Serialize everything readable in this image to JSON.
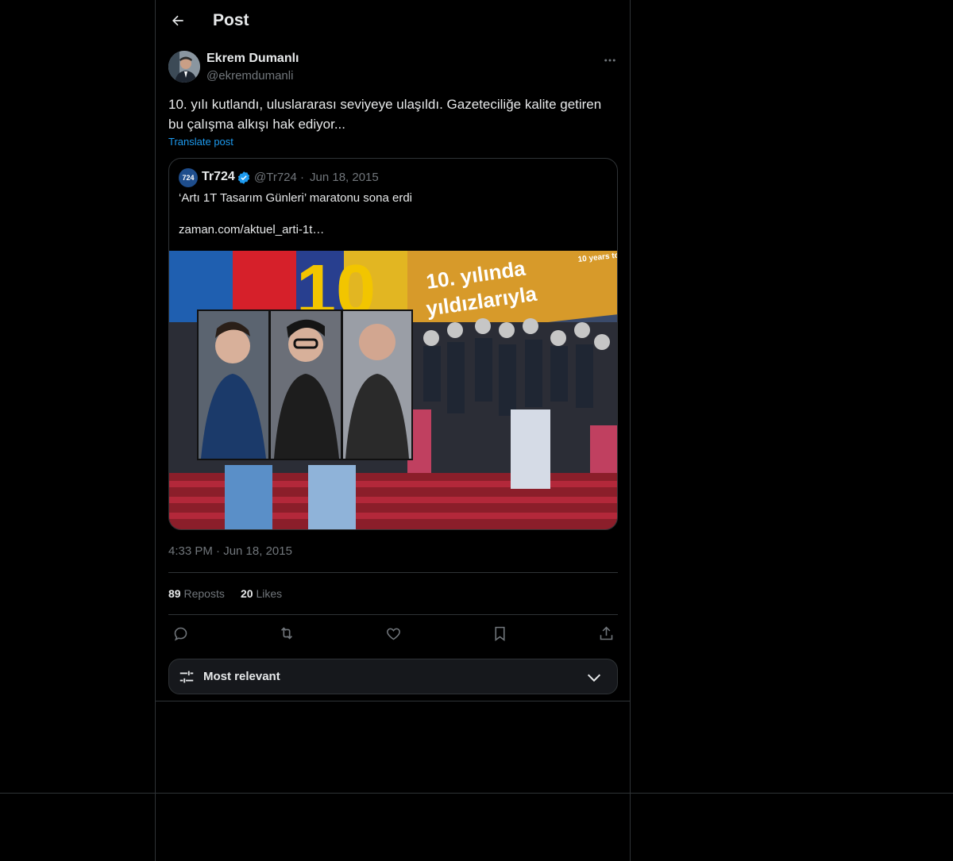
{
  "header": {
    "title": "Post"
  },
  "author": {
    "name": "Ekrem Dumanlı",
    "handle": "@ekremdumanli"
  },
  "post": {
    "text": "10. yılı kutlandı, uluslararası seviyeye ulaşıldı. Gazeteciliğe kalite getiren bu çalışma alkışı hak ediyor...",
    "translate_label": "Translate post",
    "timestamp": "4:33 PM · Jun 18, 2015"
  },
  "quote": {
    "logo_text": "724",
    "name": "Tr724",
    "verified": true,
    "handle": "@Tr724",
    "separator": "·",
    "date": "Jun 18, 2015",
    "text": "‘Artı 1T Tasarım Günleri’ maratonu sona erdi",
    "link": "zaman.com/aktuel_arti-1t…",
    "image_banner_text_1": "10. yılında",
    "image_banner_text_2": "yıldızlarıyla",
    "image_banner_small": "10 years to",
    "image_big_number": "10"
  },
  "stats": {
    "reposts_count": "89",
    "reposts_label": "Reposts",
    "likes_count": "20",
    "likes_label": "Likes"
  },
  "actions": [
    "reply-icon",
    "repost-icon",
    "like-icon",
    "bookmark-icon",
    "share-icon"
  ],
  "sort": {
    "label": "Most relevant"
  },
  "colors": {
    "background": "#000000",
    "border": "#2f3336",
    "accent": "#1d9bf0",
    "muted": "#71767b",
    "text": "#e7e9ea"
  }
}
